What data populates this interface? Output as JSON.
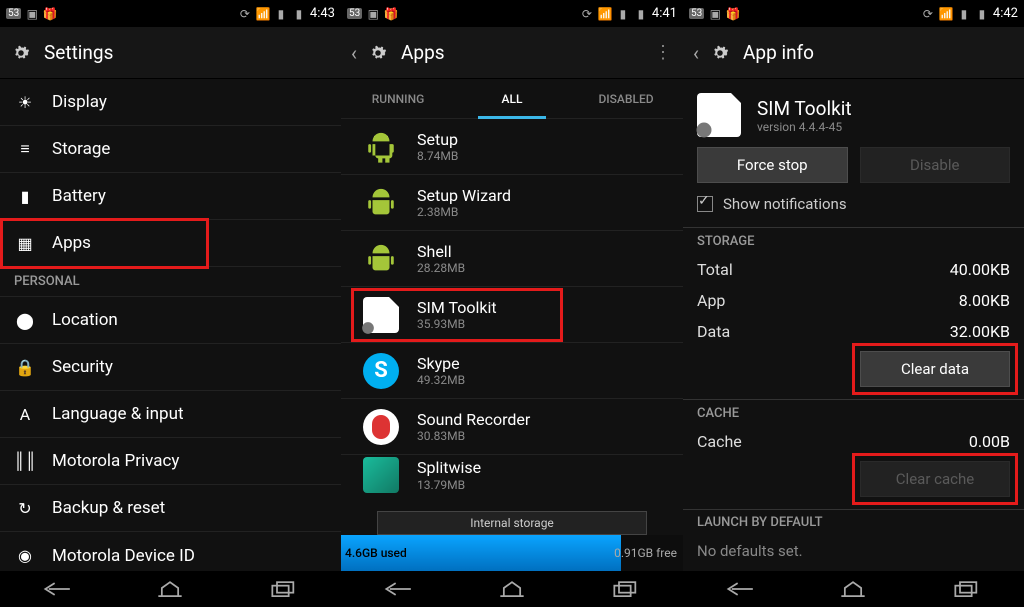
{
  "status": {
    "badge": "53",
    "time1": "4:43",
    "time2": "4:41",
    "time3": "4:42"
  },
  "settings": {
    "title": "Settings",
    "items": [
      {
        "label": "Display",
        "icon": "brightness"
      },
      {
        "label": "Storage",
        "icon": "storage"
      },
      {
        "label": "Battery",
        "icon": "battery"
      },
      {
        "label": "Apps",
        "icon": "apps",
        "highlight": true
      }
    ],
    "personal_header": "PERSONAL",
    "personal": [
      {
        "label": "Location",
        "icon": "location"
      },
      {
        "label": "Security",
        "icon": "lock"
      },
      {
        "label": "Language & input",
        "icon": "lang"
      },
      {
        "label": "Motorola Privacy",
        "icon": "privacy"
      },
      {
        "label": "Backup & reset",
        "icon": "backup"
      },
      {
        "label": "Motorola Device ID",
        "icon": "moto"
      }
    ]
  },
  "apps": {
    "title": "Apps",
    "tabs": {
      "running": "RUNNING",
      "all": "ALL",
      "disabled": "DISABLED"
    },
    "list": [
      {
        "name": "Setup",
        "size": "8.74MB",
        "icon": "android"
      },
      {
        "name": "Setup Wizard",
        "size": "2.38MB",
        "icon": "android"
      },
      {
        "name": "Shell",
        "size": "28.28MB",
        "icon": "android"
      },
      {
        "name": "SIM Toolkit",
        "size": "35.93MB",
        "icon": "sim",
        "highlight": true
      },
      {
        "name": "Skype",
        "size": "49.32MB",
        "icon": "skype"
      },
      {
        "name": "Sound Recorder",
        "size": "30.83MB",
        "icon": "rec"
      },
      {
        "name": "Splitwise",
        "size": "13.79MB",
        "icon": "splitwise"
      }
    ],
    "storage_label": "Internal storage",
    "used": "4.6GB used",
    "free": "0.91GB free"
  },
  "appinfo": {
    "title": "App info",
    "name": "SIM Toolkit",
    "version": "version 4.4.4-45",
    "force_stop": "Force stop",
    "disable": "Disable",
    "show_notifications": "Show notifications",
    "storage_header": "STORAGE",
    "total_k": "Total",
    "total_v": "40.00KB",
    "app_k": "App",
    "app_v": "8.00KB",
    "data_k": "Data",
    "data_v": "32.00KB",
    "clear_data": "Clear data",
    "cache_header": "CACHE",
    "cache_k": "Cache",
    "cache_v": "0.00B",
    "clear_cache": "Clear cache",
    "launch_header": "LAUNCH BY DEFAULT",
    "no_defaults": "No defaults set."
  }
}
